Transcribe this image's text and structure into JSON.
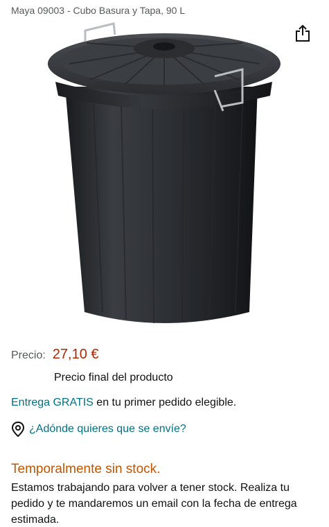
{
  "product": {
    "title": "Maya 09003 - Cubo Basura y Tapa, 90 L",
    "image_icon": "trash-bin-with-lid"
  },
  "share_icon": "share-icon",
  "price": {
    "label": "Precio:",
    "value": "27,10 €",
    "note": "Precio final del producto"
  },
  "delivery": {
    "link": "Entrega GRATIS",
    "rest": " en tu primer pedido elegible."
  },
  "location": {
    "icon": "location-pin-icon",
    "text": "¿Adónde quieres que se envíe?"
  },
  "availability": {
    "status": "Temporalmente sin stock.",
    "description": "Estamos trabajando para volver a tener stock. Realiza tu pedido y te mandaremos un email con la fecha de entrega estimada."
  },
  "colors": {
    "price": "#b12704",
    "link": "#007185",
    "stock": "#c45500",
    "text": "#0f1111",
    "muted": "#565959"
  }
}
